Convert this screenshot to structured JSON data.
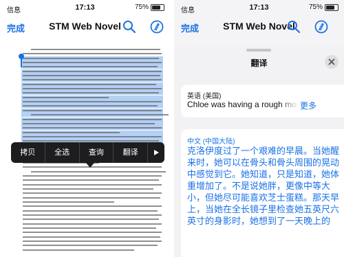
{
  "status_bar": {
    "carrier": "信息",
    "time": "17:13",
    "battery": "75%",
    "battery_level": 0.75
  },
  "left_screen": {
    "navbar": {
      "done_label": "完成",
      "title": "STM Web Novel",
      "search_icon": "search-icon",
      "markup_icon": "pen-circle-icon"
    },
    "page_image": {
      "body": "Chloe was having a rough morning. She could feel it in her bones and the jiggles around those bones when she woke up. She groaned and rolled over to silence the alarm. Today she would be late again. The morning light spilled through the curtains and she wished for more sleep."
    },
    "edit_menu": {
      "items": [
        "拷贝",
        "全选",
        "查询",
        "翻译"
      ],
      "more_icon": "triangle-right-icon"
    }
  },
  "right_screen": {
    "navbar": {
      "done_label": "完成",
      "title": "STM Web Novel",
      "search_icon": "search-icon",
      "markup_icon": "pen-circle-icon"
    },
    "translate_sheet": {
      "title": "翻译",
      "close_icon": "close-icon",
      "source_language": "英语 (美国)",
      "source_text": "Chloe was having a rough morning",
      "more_label": "更多",
      "target_language": "中文 (中国大陆)",
      "target_text": "克洛伊度过了一个艰难的早晨。当她醒来时，她可以在骨头和骨头周围的晃动中感觉到它。她知道，只是知道，她体重增加了。不是说她胖，更像中等大小，但她尽可能喜欢芝士蛋糕。那天早上，当她在全长镜子里检查她五英尺六英寸的身影时，她想到了一天晚上的"
    }
  },
  "colors": {
    "accent": "#1a72e8",
    "menu_bg": "#1d1d1f",
    "selection": "#8bb7f0"
  }
}
